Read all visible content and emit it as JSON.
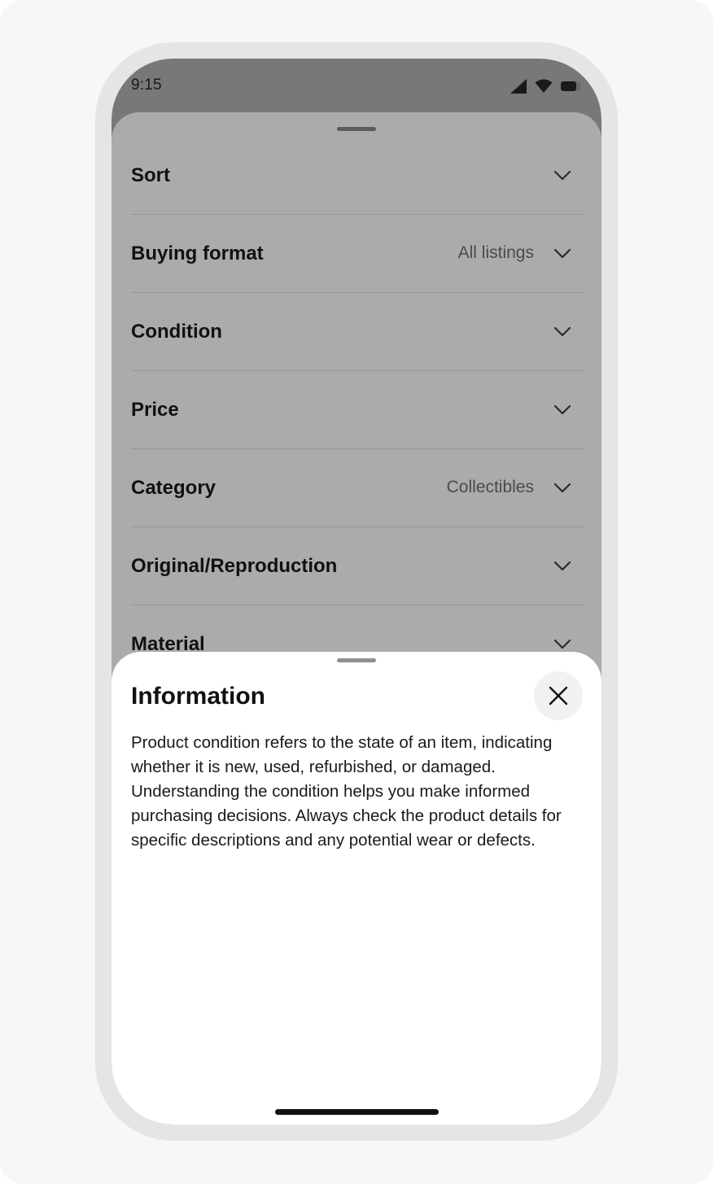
{
  "status_bar": {
    "time": "9:15",
    "icons": [
      "cellular-signal-icon",
      "wifi-icon",
      "battery-icon"
    ]
  },
  "filters": [
    {
      "label": "Sort",
      "value": ""
    },
    {
      "label": "Buying format",
      "value": "All listings"
    },
    {
      "label": "Condition",
      "value": ""
    },
    {
      "label": "Price",
      "value": ""
    },
    {
      "label": "Category",
      "value": "Collectibles"
    },
    {
      "label": "Original/Reproduction",
      "value": ""
    },
    {
      "label": "Material",
      "value": ""
    }
  ],
  "info_sheet": {
    "title": "Information",
    "body": "Product condition refers to the state of an item, indicating whether it is new, used, refurbished, or damaged. Understanding the condition helps you make informed purchasing decisions. Always check the product details for specific descriptions and any potential wear or defects.",
    "close_icon": "close-icon"
  },
  "colors": {
    "background": "#f7f7f7",
    "device_frame": "#e5e5e5",
    "scrim": "#787878",
    "filter_sheet": "#ababab",
    "info_sheet": "#ffffff",
    "text_primary": "#111111"
  }
}
